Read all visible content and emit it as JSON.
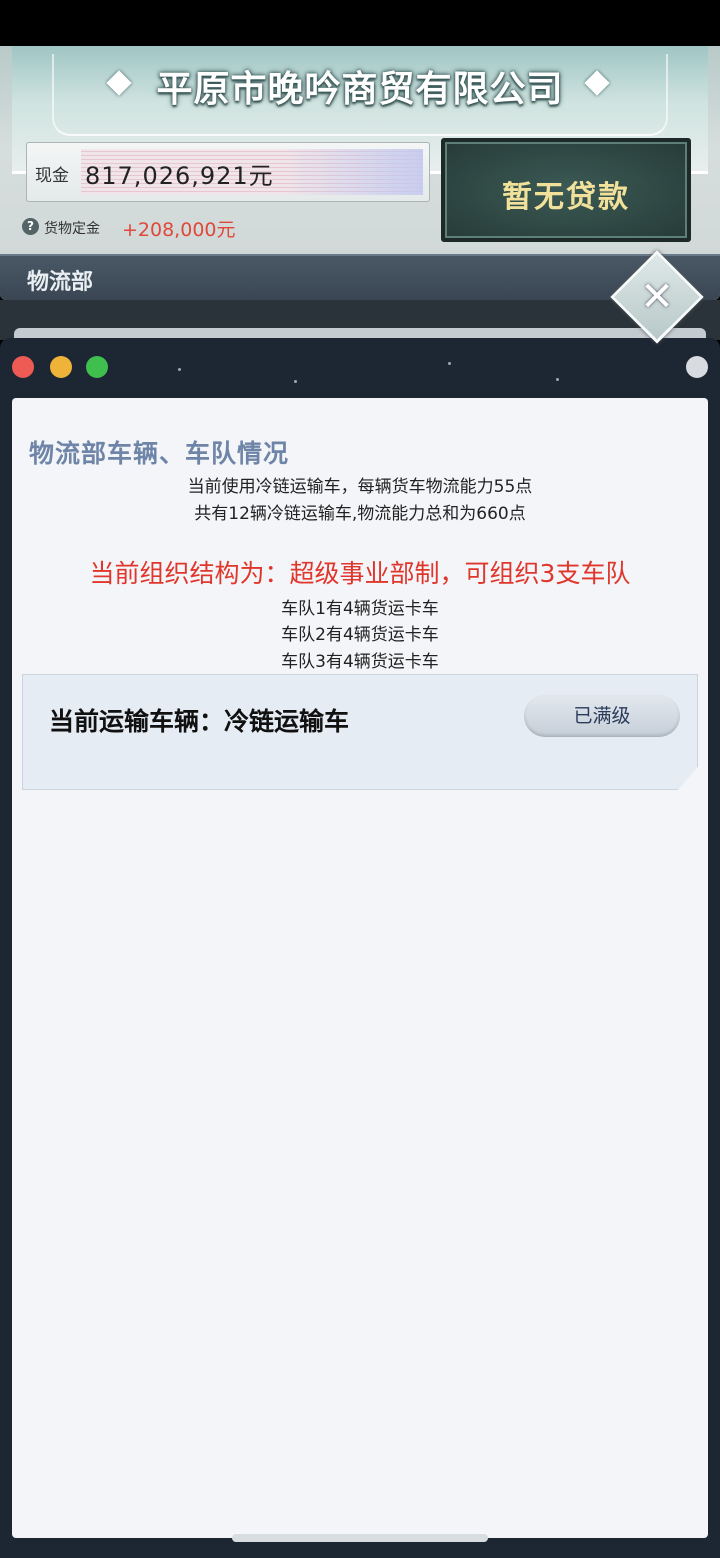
{
  "header": {
    "company_name": "平原市晚吟商贸有限公司",
    "cash_label": "现金",
    "cash_value": "817,026,921元",
    "loan_button": "暂无贷款",
    "deposit_label": "货物定金",
    "deposit_value": "+208,000元",
    "help_icon": "?",
    "department": "物流部",
    "close_icon": "✕"
  },
  "panel": {
    "title": "物流部车辆、车队情况",
    "info_lines": [
      "当前使用冷链运输车，每辆货车物流能力55点",
      "共有12辆冷链运输车,物流能力总和为660点"
    ],
    "org_structure": "当前组织结构为：超级事业部制，可组织3支车队",
    "teams": [
      "车队1有4辆货运卡车",
      "车队2有4辆货运卡车",
      "车队3有4辆货运卡车"
    ],
    "vehicle_label": "当前运输车辆：冷链运输车",
    "upgrade_button": "已满级"
  },
  "colors": {
    "accent_red": "#e0362c",
    "title_blue": "#6e85a8",
    "loan_text": "#f1e19a",
    "window_bg": "#1d2633"
  }
}
